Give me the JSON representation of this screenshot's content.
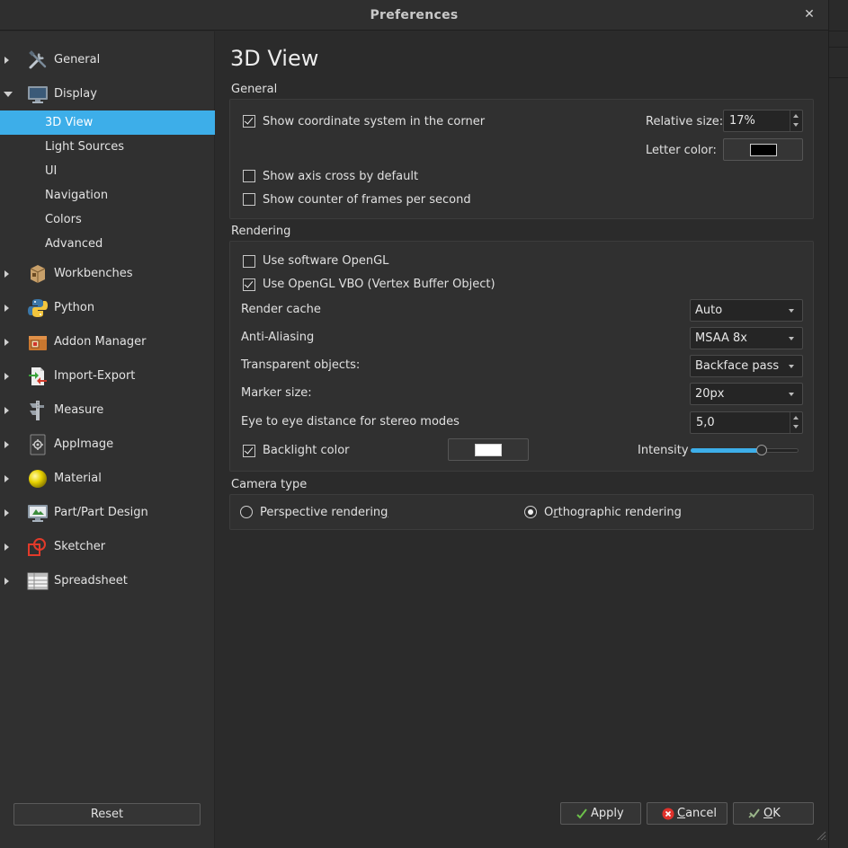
{
  "window": {
    "title": "Preferences"
  },
  "sidebar": {
    "items": [
      {
        "label": "General",
        "icon": "tools-icon",
        "expanded": false
      },
      {
        "label": "Display",
        "icon": "monitor-icon",
        "expanded": true,
        "children": [
          "3D View",
          "Light Sources",
          "UI",
          "Navigation",
          "Colors",
          "Advanced"
        ],
        "selected_child": "3D View"
      },
      {
        "label": "Workbenches",
        "icon": "workbench-box-icon",
        "expanded": false
      },
      {
        "label": "Python",
        "icon": "python-icon",
        "expanded": false
      },
      {
        "label": "Addon Manager",
        "icon": "addon-manager-icon",
        "expanded": false
      },
      {
        "label": "Import-Export",
        "icon": "import-export-icon",
        "expanded": false
      },
      {
        "label": "Measure",
        "icon": "measure-caliper-icon",
        "expanded": false
      },
      {
        "label": "AppImage",
        "icon": "appimage-icon",
        "expanded": false
      },
      {
        "label": "Material",
        "icon": "material-sphere-icon",
        "expanded": false
      },
      {
        "label": "Part/Part Design",
        "icon": "part-design-icon",
        "expanded": false
      },
      {
        "label": "Sketcher",
        "icon": "sketcher-icon",
        "expanded": false
      },
      {
        "label": "Spreadsheet",
        "icon": "spreadsheet-icon",
        "expanded": false
      }
    ],
    "reset_label": "Reset"
  },
  "page": {
    "title": "3D View",
    "general": {
      "heading": "General",
      "show_coord_system": {
        "label": "Show coordinate system in the corner",
        "checked": true
      },
      "relative_size": {
        "label": "Relative size:",
        "value": "17%"
      },
      "letter_color": {
        "label": "Letter color:",
        "color": "#000000"
      },
      "show_axis_cross": {
        "label": "Show axis cross by default",
        "checked": false
      },
      "show_fps": {
        "label": "Show counter of frames per second",
        "checked": false
      }
    },
    "rendering": {
      "heading": "Rendering",
      "software_opengl": {
        "label": "Use software OpenGL",
        "checked": false
      },
      "opengl_vbo": {
        "label": "Use OpenGL VBO (Vertex Buffer Object)",
        "checked": true
      },
      "render_cache": {
        "label": "Render cache",
        "value": "Auto"
      },
      "anti_aliasing": {
        "label": "Anti-Aliasing",
        "value": "MSAA 8x"
      },
      "transparent_objects": {
        "label": "Transparent objects:",
        "value": "Backface pass"
      },
      "marker_size": {
        "label": "Marker size:",
        "value": "20px"
      },
      "eye_distance": {
        "label": "Eye to eye distance for stereo modes",
        "value": "5,0"
      },
      "backlight": {
        "label": "Backlight color",
        "checked": true,
        "color": "#ffffff"
      },
      "intensity": {
        "label": "Intensity",
        "fraction": 0.68
      }
    },
    "camera": {
      "heading": "Camera type",
      "perspective": {
        "label_pre": "Perspective renderin",
        "label_key": "g",
        "label_post": "",
        "checked": false
      },
      "orthographic": {
        "label_pre": "O",
        "label_key": "r",
        "label_post": "thographic rendering",
        "checked": true
      }
    }
  },
  "buttons": {
    "apply": {
      "label": "Apply",
      "icon": "checkmark-icon"
    },
    "cancel": {
      "label_key": "C",
      "label_rest": "ancel",
      "icon": "cancel-icon"
    },
    "ok": {
      "label_key": "O",
      "label_rest": "K",
      "icon": "ok-icon"
    }
  },
  "colors": {
    "accent": "#3daee9",
    "window_bg": "#2b2b2b",
    "sidebar_bg": "#303030"
  }
}
